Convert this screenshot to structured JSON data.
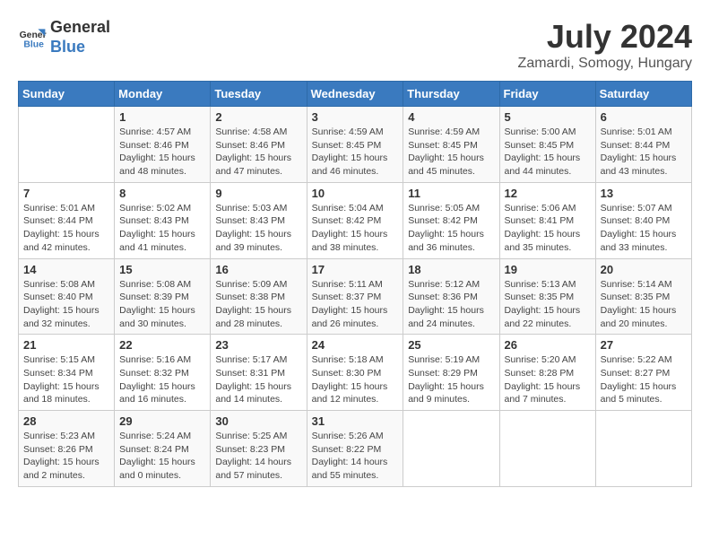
{
  "header": {
    "logo_line1": "General",
    "logo_line2": "Blue",
    "month_year": "July 2024",
    "location": "Zamardi, Somogy, Hungary"
  },
  "days_of_week": [
    "Sunday",
    "Monday",
    "Tuesday",
    "Wednesday",
    "Thursday",
    "Friday",
    "Saturday"
  ],
  "weeks": [
    [
      {
        "day": "",
        "info": ""
      },
      {
        "day": "1",
        "info": "Sunrise: 4:57 AM\nSunset: 8:46 PM\nDaylight: 15 hours\nand 48 minutes."
      },
      {
        "day": "2",
        "info": "Sunrise: 4:58 AM\nSunset: 8:46 PM\nDaylight: 15 hours\nand 47 minutes."
      },
      {
        "day": "3",
        "info": "Sunrise: 4:59 AM\nSunset: 8:45 PM\nDaylight: 15 hours\nand 46 minutes."
      },
      {
        "day": "4",
        "info": "Sunrise: 4:59 AM\nSunset: 8:45 PM\nDaylight: 15 hours\nand 45 minutes."
      },
      {
        "day": "5",
        "info": "Sunrise: 5:00 AM\nSunset: 8:45 PM\nDaylight: 15 hours\nand 44 minutes."
      },
      {
        "day": "6",
        "info": "Sunrise: 5:01 AM\nSunset: 8:44 PM\nDaylight: 15 hours\nand 43 minutes."
      }
    ],
    [
      {
        "day": "7",
        "info": "Sunrise: 5:01 AM\nSunset: 8:44 PM\nDaylight: 15 hours\nand 42 minutes."
      },
      {
        "day": "8",
        "info": "Sunrise: 5:02 AM\nSunset: 8:43 PM\nDaylight: 15 hours\nand 41 minutes."
      },
      {
        "day": "9",
        "info": "Sunrise: 5:03 AM\nSunset: 8:43 PM\nDaylight: 15 hours\nand 39 minutes."
      },
      {
        "day": "10",
        "info": "Sunrise: 5:04 AM\nSunset: 8:42 PM\nDaylight: 15 hours\nand 38 minutes."
      },
      {
        "day": "11",
        "info": "Sunrise: 5:05 AM\nSunset: 8:42 PM\nDaylight: 15 hours\nand 36 minutes."
      },
      {
        "day": "12",
        "info": "Sunrise: 5:06 AM\nSunset: 8:41 PM\nDaylight: 15 hours\nand 35 minutes."
      },
      {
        "day": "13",
        "info": "Sunrise: 5:07 AM\nSunset: 8:40 PM\nDaylight: 15 hours\nand 33 minutes."
      }
    ],
    [
      {
        "day": "14",
        "info": "Sunrise: 5:08 AM\nSunset: 8:40 PM\nDaylight: 15 hours\nand 32 minutes."
      },
      {
        "day": "15",
        "info": "Sunrise: 5:08 AM\nSunset: 8:39 PM\nDaylight: 15 hours\nand 30 minutes."
      },
      {
        "day": "16",
        "info": "Sunrise: 5:09 AM\nSunset: 8:38 PM\nDaylight: 15 hours\nand 28 minutes."
      },
      {
        "day": "17",
        "info": "Sunrise: 5:11 AM\nSunset: 8:37 PM\nDaylight: 15 hours\nand 26 minutes."
      },
      {
        "day": "18",
        "info": "Sunrise: 5:12 AM\nSunset: 8:36 PM\nDaylight: 15 hours\nand 24 minutes."
      },
      {
        "day": "19",
        "info": "Sunrise: 5:13 AM\nSunset: 8:35 PM\nDaylight: 15 hours\nand 22 minutes."
      },
      {
        "day": "20",
        "info": "Sunrise: 5:14 AM\nSunset: 8:35 PM\nDaylight: 15 hours\nand 20 minutes."
      }
    ],
    [
      {
        "day": "21",
        "info": "Sunrise: 5:15 AM\nSunset: 8:34 PM\nDaylight: 15 hours\nand 18 minutes."
      },
      {
        "day": "22",
        "info": "Sunrise: 5:16 AM\nSunset: 8:32 PM\nDaylight: 15 hours\nand 16 minutes."
      },
      {
        "day": "23",
        "info": "Sunrise: 5:17 AM\nSunset: 8:31 PM\nDaylight: 15 hours\nand 14 minutes."
      },
      {
        "day": "24",
        "info": "Sunrise: 5:18 AM\nSunset: 8:30 PM\nDaylight: 15 hours\nand 12 minutes."
      },
      {
        "day": "25",
        "info": "Sunrise: 5:19 AM\nSunset: 8:29 PM\nDaylight: 15 hours\nand 9 minutes."
      },
      {
        "day": "26",
        "info": "Sunrise: 5:20 AM\nSunset: 8:28 PM\nDaylight: 15 hours\nand 7 minutes."
      },
      {
        "day": "27",
        "info": "Sunrise: 5:22 AM\nSunset: 8:27 PM\nDaylight: 15 hours\nand 5 minutes."
      }
    ],
    [
      {
        "day": "28",
        "info": "Sunrise: 5:23 AM\nSunset: 8:26 PM\nDaylight: 15 hours\nand 2 minutes."
      },
      {
        "day": "29",
        "info": "Sunrise: 5:24 AM\nSunset: 8:24 PM\nDaylight: 15 hours\nand 0 minutes."
      },
      {
        "day": "30",
        "info": "Sunrise: 5:25 AM\nSunset: 8:23 PM\nDaylight: 14 hours\nand 57 minutes."
      },
      {
        "day": "31",
        "info": "Sunrise: 5:26 AM\nSunset: 8:22 PM\nDaylight: 14 hours\nand 55 minutes."
      },
      {
        "day": "",
        "info": ""
      },
      {
        "day": "",
        "info": ""
      },
      {
        "day": "",
        "info": ""
      }
    ]
  ]
}
